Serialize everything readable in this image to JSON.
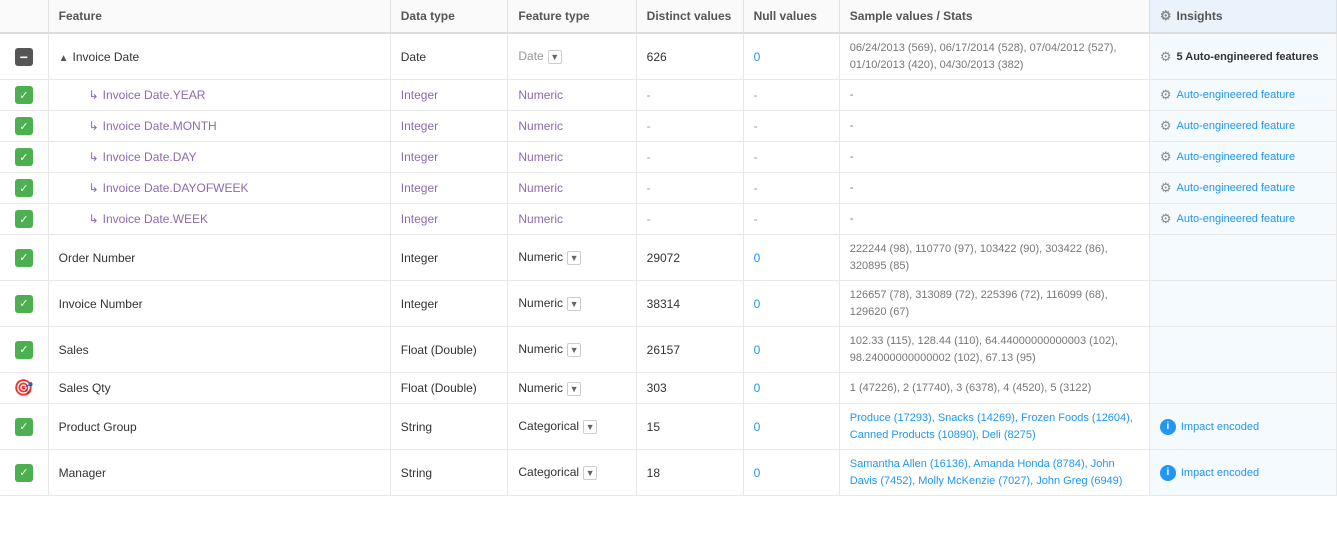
{
  "columns": {
    "feature": "Feature",
    "datatype": "Data type",
    "featuretype": "Feature type",
    "distinct": "Distinct values",
    "null": "Null values",
    "sample": "Sample values / Stats",
    "insights": "Insights"
  },
  "rows": [
    {
      "id": "invoice-date",
      "checkboxType": "minus",
      "feature": "Invoice Date",
      "featurePrefix": "▲",
      "datatype": "Date",
      "datatypeStyle": "normal",
      "featuretypeText": "Date",
      "featuretypeStyle": "gray",
      "hasDropdown": true,
      "distinct": "626",
      "distinctStyle": "normal",
      "null": "0",
      "nullStyle": "blue",
      "sample": "06/24/2013 (569), 06/17/2014 (528), 07/04/2012 (527), 01/10/2013 (420), 04/30/2013 (382)",
      "sampleStyle": "normal",
      "insightsText": "5 Auto-engineered features",
      "insightsStyle": "bold",
      "insightsIcon": "gear"
    },
    {
      "id": "invoice-date-year",
      "checkboxType": "green",
      "feature": "Invoice Date.YEAR",
      "featurePrefix": "↳",
      "indented": true,
      "datatype": "Integer",
      "datatypeStyle": "purple",
      "featuretypeText": "Numeric",
      "featuretypeStyle": "purple",
      "hasDropdown": false,
      "distinct": "-",
      "distinctStyle": "gray",
      "null": "-",
      "nullStyle": "gray",
      "sample": "-",
      "sampleStyle": "gray",
      "insightsText": "Auto-engineered feature",
      "insightsStyle": "link",
      "insightsIcon": "gear"
    },
    {
      "id": "invoice-date-month",
      "checkboxType": "green",
      "feature": "Invoice Date.MONTH",
      "featurePrefix": "↳",
      "indented": true,
      "datatype": "Integer",
      "datatypeStyle": "purple",
      "featuretypeText": "Numeric",
      "featuretypeStyle": "purple",
      "hasDropdown": false,
      "distinct": "-",
      "distinctStyle": "gray",
      "null": "-",
      "nullStyle": "gray",
      "sample": "-",
      "sampleStyle": "gray",
      "insightsText": "Auto-engineered feature",
      "insightsStyle": "link",
      "insightsIcon": "gear"
    },
    {
      "id": "invoice-date-day",
      "checkboxType": "green",
      "feature": "Invoice Date.DAY",
      "featurePrefix": "↳",
      "indented": true,
      "datatype": "Integer",
      "datatypeStyle": "purple",
      "featuretypeText": "Numeric",
      "featuretypeStyle": "purple",
      "hasDropdown": false,
      "distinct": "-",
      "distinctStyle": "gray",
      "null": "-",
      "nullStyle": "gray",
      "sample": "-",
      "sampleStyle": "gray",
      "insightsText": "Auto-engineered feature",
      "insightsStyle": "link",
      "insightsIcon": "gear"
    },
    {
      "id": "invoice-date-dayofweek",
      "checkboxType": "green",
      "feature": "Invoice Date.DAYOFWEEK",
      "featurePrefix": "↳",
      "indented": true,
      "datatype": "Integer",
      "datatypeStyle": "purple",
      "featuretypeText": "Numeric",
      "featuretypeStyle": "purple",
      "hasDropdown": false,
      "distinct": "-",
      "distinctStyle": "gray",
      "null": "-",
      "nullStyle": "gray",
      "sample": "-",
      "sampleStyle": "gray",
      "insightsText": "Auto-engineered feature",
      "insightsStyle": "link",
      "insightsIcon": "gear"
    },
    {
      "id": "invoice-date-week",
      "checkboxType": "green",
      "feature": "Invoice Date.WEEK",
      "featurePrefix": "↳",
      "indented": true,
      "datatype": "Integer",
      "datatypeStyle": "purple",
      "featuretypeText": "Numeric",
      "featuretypeStyle": "purple",
      "hasDropdown": false,
      "distinct": "-",
      "distinctStyle": "gray",
      "null": "-",
      "nullStyle": "gray",
      "sample": "-",
      "sampleStyle": "gray",
      "insightsText": "Auto-engineered feature",
      "insightsStyle": "link",
      "insightsIcon": "gear"
    },
    {
      "id": "order-number",
      "checkboxType": "green",
      "feature": "Order Number",
      "featurePrefix": "",
      "indented": false,
      "datatype": "Integer",
      "datatypeStyle": "normal",
      "featuretypeText": "Numeric",
      "featuretypeStyle": "normal",
      "hasDropdown": true,
      "distinct": "29072",
      "distinctStyle": "normal",
      "null": "0",
      "nullStyle": "blue",
      "sample": "222244 (98), 110770 (97), 103422 (90), 303422 (86), 320895 (85)",
      "sampleStyle": "normal",
      "insightsText": "",
      "insightsStyle": "none",
      "insightsIcon": ""
    },
    {
      "id": "invoice-number",
      "checkboxType": "green",
      "feature": "Invoice Number",
      "featurePrefix": "",
      "indented": false,
      "datatype": "Integer",
      "datatypeStyle": "normal",
      "featuretypeText": "Numeric",
      "featuretypeStyle": "normal",
      "hasDropdown": true,
      "distinct": "38314",
      "distinctStyle": "normal",
      "null": "0",
      "nullStyle": "blue",
      "sample": "126657 (78), 313089 (72), 225396 (72), 116099 (68), 129620 (67)",
      "sampleStyle": "normal",
      "insightsText": "",
      "insightsStyle": "none",
      "insightsIcon": ""
    },
    {
      "id": "sales",
      "checkboxType": "green",
      "feature": "Sales",
      "featurePrefix": "",
      "indented": false,
      "datatype": "Float (Double)",
      "datatypeStyle": "normal",
      "featuretypeText": "Numeric",
      "featuretypeStyle": "normal",
      "hasDropdown": true,
      "distinct": "26157",
      "distinctStyle": "normal",
      "null": "0",
      "nullStyle": "blue",
      "sample": "102.33 (115), 128.44 (110), 64.44000000000003 (102), 98.24000000000002 (102), 67.13 (95)",
      "sampleStyle": "normal",
      "insightsText": "",
      "insightsStyle": "none",
      "insightsIcon": ""
    },
    {
      "id": "sales-qty",
      "checkboxType": "target",
      "feature": "Sales Qty",
      "featurePrefix": "",
      "indented": false,
      "datatype": "Float (Double)",
      "datatypeStyle": "normal",
      "featuretypeText": "Numeric",
      "featuretypeStyle": "normal",
      "hasDropdown": true,
      "distinct": "303",
      "distinctStyle": "normal",
      "null": "0",
      "nullStyle": "blue",
      "sample": "1 (47226), 2 (17740), 3 (6378), 4 (4520), 5 (3122)",
      "sampleStyle": "normal",
      "insightsText": "",
      "insightsStyle": "none",
      "insightsIcon": ""
    },
    {
      "id": "product-group",
      "checkboxType": "green",
      "feature": "Product Group",
      "featurePrefix": "",
      "indented": false,
      "datatype": "String",
      "datatypeStyle": "normal",
      "featuretypeText": "Categorical",
      "featuretypeStyle": "normal",
      "hasDropdown": true,
      "distinct": "15",
      "distinctStyle": "normal",
      "null": "0",
      "nullStyle": "blue",
      "sample": "Produce (17293), Snacks (14269), Frozen Foods (12604), Canned Products (10890), Deli (8275)",
      "sampleStyle": "link",
      "insightsText": "Impact encoded",
      "insightsStyle": "link",
      "insightsIcon": "info"
    },
    {
      "id": "manager",
      "checkboxType": "green",
      "feature": "Manager",
      "featurePrefix": "",
      "indented": false,
      "datatype": "String",
      "datatypeStyle": "normal",
      "featuretypeText": "Categorical",
      "featuretypeStyle": "normal",
      "hasDropdown": true,
      "distinct": "18",
      "distinctStyle": "normal",
      "null": "0",
      "nullStyle": "blue",
      "sample": "Samantha Allen (16136), Amanda Honda (8784), John Davis (7452), Molly McKenzie (7027), John Greg (6949)",
      "sampleStyle": "link",
      "insightsText": "Impact encoded",
      "insightsStyle": "link",
      "insightsIcon": "info"
    }
  ]
}
